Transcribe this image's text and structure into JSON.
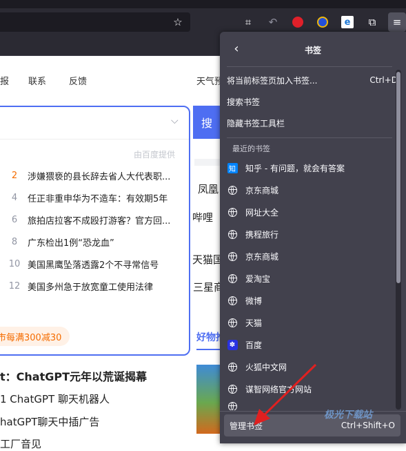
{
  "page": {
    "nav": [
      "报",
      "联系",
      "反馈",
      "天气预"
    ],
    "search": {
      "button_label": "搜",
      "provider_note": "由百度提供"
    },
    "hot_list": [
      {
        "rank": "2",
        "text": "涉嫌猥亵的县长辞去省人大代表职..."
      },
      {
        "rank": "4",
        "text": "任正非重申华为不造车：有效期5年"
      },
      {
        "rank": "6",
        "text": "旅拍店拉客不成殴打游客？官方回..."
      },
      {
        "rank": "8",
        "text": "广东检出1例“恐龙血”"
      },
      {
        "rank": "10",
        "text": "美国黑鹰坠落透露2个不寻常信号"
      },
      {
        "rank": "12",
        "text": "美国多州急于放宽童工使用法律"
      }
    ],
    "promo": "市每满300减30",
    "right_items": [
      "凤凰",
      "哔哩",
      "天猫国",
      "三星商"
    ],
    "tab_label": "好物推",
    "news": [
      "t：ChatGPT元年以荒诞揭幕",
      "1 ChatGPT 聊天机器人",
      "hatGPT聊天中插广告",
      "工厂音见"
    ]
  },
  "panel": {
    "title": "书签",
    "actions": [
      {
        "label": "将当前标签页加入书签...",
        "shortcut": "Ctrl+D"
      },
      {
        "label": "搜索书签",
        "shortcut": ""
      },
      {
        "label": "隐藏书签工具栏",
        "shortcut": ""
      }
    ],
    "recent_label": "最近的书签",
    "bookmarks": [
      {
        "label": "知乎 - 有问题，就会有答案",
        "icon": "zhihu-icon"
      },
      {
        "label": "京东商城",
        "icon": "globe-icon"
      },
      {
        "label": "网址大全",
        "icon": "globe-icon"
      },
      {
        "label": "携程旅行",
        "icon": "globe-icon"
      },
      {
        "label": "京东商城",
        "icon": "globe-icon"
      },
      {
        "label": "爱淘宝",
        "icon": "globe-icon"
      },
      {
        "label": "微博",
        "icon": "globe-icon"
      },
      {
        "label": "天猫",
        "icon": "globe-icon"
      },
      {
        "label": "百度",
        "icon": "baidu-icon"
      },
      {
        "label": "火狐中文网",
        "icon": "globe-icon"
      },
      {
        "label": "谋智网络官方网站",
        "icon": "globe-icon"
      },
      {
        "label": "",
        "icon": "globe-icon"
      }
    ],
    "footer": {
      "label": "管理书签",
      "shortcut": "Ctrl+Shift+O"
    }
  },
  "watermark": "极光下载站",
  "colors": {
    "panel_bg": "#42414d",
    "accent_blue": "#4e6ef2",
    "arrow_red": "#e02020",
    "hot_red": "#f56c00"
  }
}
